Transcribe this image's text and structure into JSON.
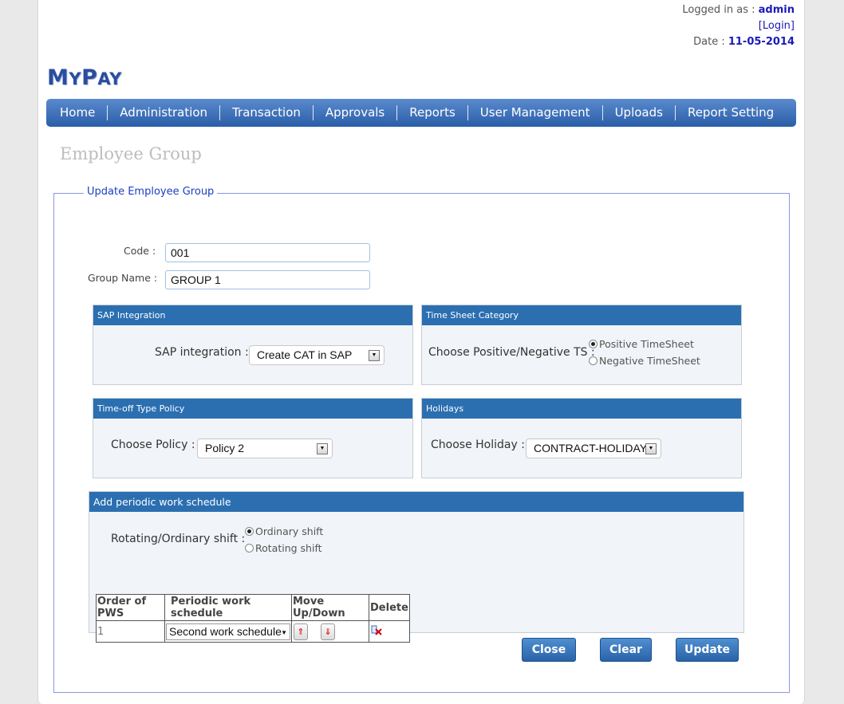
{
  "header": {
    "logged_in_label": "Logged in as : ",
    "username": "admin",
    "login_link": "[Login]",
    "date_label": "Date : ",
    "date": "11-05-2014"
  },
  "logo": {
    "text_m": "M",
    "text_y": "Y",
    "text_p": "P",
    "text_ay": "AY"
  },
  "nav": [
    "Home",
    "Administration",
    "Transaction",
    "Approvals",
    "Reports",
    "User Management",
    "Uploads",
    "Report Setting"
  ],
  "page_title": "Employee Group",
  "form": {
    "legend": "Update Employee Group",
    "code_label": "Code :",
    "code_value": "001",
    "group_name_label": "Group Name :",
    "group_name_value": "GROUP 1"
  },
  "sap_panel": {
    "title": "SAP Integration",
    "label": "SAP integration :",
    "selected": "Create CAT in SAP"
  },
  "timesheet_panel": {
    "title": "Time Sheet Category",
    "label": "Choose Positive/Negative TS :",
    "options": [
      "Positive TimeSheet",
      "Negative TimeSheet"
    ],
    "selected_index": 0
  },
  "timeoff_panel": {
    "title": "Time-off Type Policy",
    "label": "Choose Policy :",
    "selected": "Policy 2"
  },
  "holidays_panel": {
    "title": "Holidays",
    "label": "Choose Holiday :",
    "selected": "CONTRACT-HOLIDAY"
  },
  "pws_panel": {
    "title": "Add periodic work schedule",
    "shift_label": "Rotating/Ordinary shift :",
    "shift_options": [
      "Ordinary shift",
      "Rotating shift"
    ],
    "selected_index": 0,
    "table": {
      "headers": [
        "Order of PWS",
        "Periodic work schedule",
        "Move Up/Down",
        "Delete"
      ],
      "rows": [
        {
          "order": "1",
          "schedule": "Second work schedule"
        }
      ]
    }
  },
  "buttons": {
    "close": "Close",
    "clear": "Clear",
    "update": "Update"
  },
  "colors": {
    "nav": "#2a5ea8",
    "panel_header": "#2b6fb1",
    "accent_text": "#1a1ab8"
  }
}
